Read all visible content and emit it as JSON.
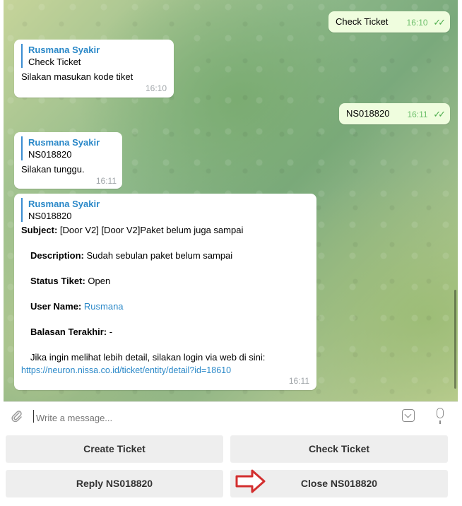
{
  "chat": {
    "messages": [
      {
        "text": "Check Ticket",
        "time": "16:10"
      },
      {
        "reply_name": "Rusmana Syakir",
        "reply_text": "Check Ticket",
        "text": "Silakan masukan kode tiket",
        "time": "16:10"
      },
      {
        "text": "NS018820",
        "time": "16:11"
      },
      {
        "reply_name": "Rusmana Syakir",
        "reply_text": "NS018820",
        "text": "Silakan tunggu.",
        "time": "16:11"
      },
      {
        "reply_name": "Rusmana Syakir",
        "reply_text": "NS018820",
        "subject_label": "Subject:",
        "subject_value": "[Door V2] [Door V2]Paket belum juga sampai",
        "description_label": "Description:",
        "description_value": "Sudah sebulan paket belum sampai",
        "status_label": "Status Tiket:",
        "status_value": "Open",
        "username_label": "User Name:",
        "username_value": "Rusmana",
        "last_reply_label": "Balasan Terakhir:",
        "last_reply_value": "-",
        "detail_text": "Jika ingin melihat lebih detail, silakan login via web di sini:",
        "detail_link": "https://neuron.nissa.co.id/ticket/entity/detail?id=18610",
        "time": "16:11"
      }
    ]
  },
  "composer": {
    "placeholder": "Write a message..."
  },
  "keyboard": {
    "buttons": [
      "Create Ticket",
      "Check Ticket",
      "Reply NS018820",
      "Close NS018820"
    ]
  },
  "icons": {
    "attach": "paperclip-icon",
    "emoji": "sticker-icon",
    "mic": "microphone-icon",
    "read": "double-check-icon",
    "arrow": "red-arrow-icon"
  },
  "colors": {
    "reply_accent": "#2a88c8",
    "outgoing_bubble": "#effdde",
    "read_ticks": "#4fae4e",
    "arrow": "#d32f2f"
  }
}
